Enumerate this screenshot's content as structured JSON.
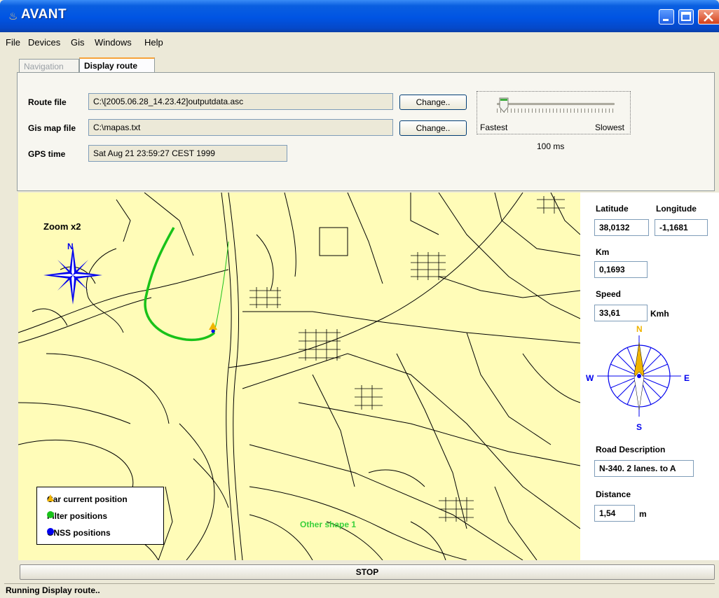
{
  "window": {
    "title": "AVANT",
    "app_icon": "java-cup-icon"
  },
  "menu": {
    "items": [
      "File",
      "Devices",
      "Gis",
      "Windows",
      "Help"
    ]
  },
  "tabs": [
    {
      "label": "Navigation",
      "selected": false
    },
    {
      "label": "Display route",
      "selected": true
    }
  ],
  "route_panel": {
    "route_file": {
      "label": "Route file",
      "value": "C:\\[2005.06.28_14.23.42]outputdata.asc",
      "button": "Change.."
    },
    "gis_map_file": {
      "label": "Gis map file",
      "value": "C:\\mapas.txt",
      "button": "Change.."
    },
    "gps_time": {
      "label": "GPS time",
      "value": "Sat Aug 21 23:59:27 CEST 1999"
    }
  },
  "speed_slider": {
    "min_label": "Fastest",
    "max_label": "Slowest",
    "value_label": "100 ms",
    "position_fraction": 0.06
  },
  "map": {
    "zoom_label": "Zoom x2",
    "compass_rose_north": "N",
    "shape_label": "Other shape 1",
    "legend": [
      {
        "label": "Car current position",
        "symbol": "triangle",
        "color": "#f0b400"
      },
      {
        "label": "Filter positions",
        "symbol": "circle",
        "color": "#19c219"
      },
      {
        "label": "GNSS positions",
        "symbol": "circle",
        "color": "#0000ee"
      }
    ],
    "colors": {
      "background": "#fffcb8",
      "roads": "#000000",
      "route": "#19c219",
      "compass": "#0000ee"
    }
  },
  "side_panel": {
    "latitude": {
      "label": "Latitude",
      "value": "38,0132"
    },
    "longitude": {
      "label": "Longitude",
      "value": "-1,1681"
    },
    "km": {
      "label": "Km",
      "value": "0,1693"
    },
    "speed": {
      "label": "Speed",
      "value": "33,61",
      "unit": "Kmh"
    },
    "compass": {
      "n": "N",
      "s": "S",
      "e": "E",
      "w": "W"
    },
    "road_description": {
      "label": "Road Description",
      "value": "N-340. 2 lanes. to A"
    },
    "distance": {
      "label": "Distance",
      "value": "1,54",
      "unit": "m"
    }
  },
  "stop_button": {
    "label": "STOP"
  },
  "status_bar": {
    "text": "Running Display route.."
  }
}
